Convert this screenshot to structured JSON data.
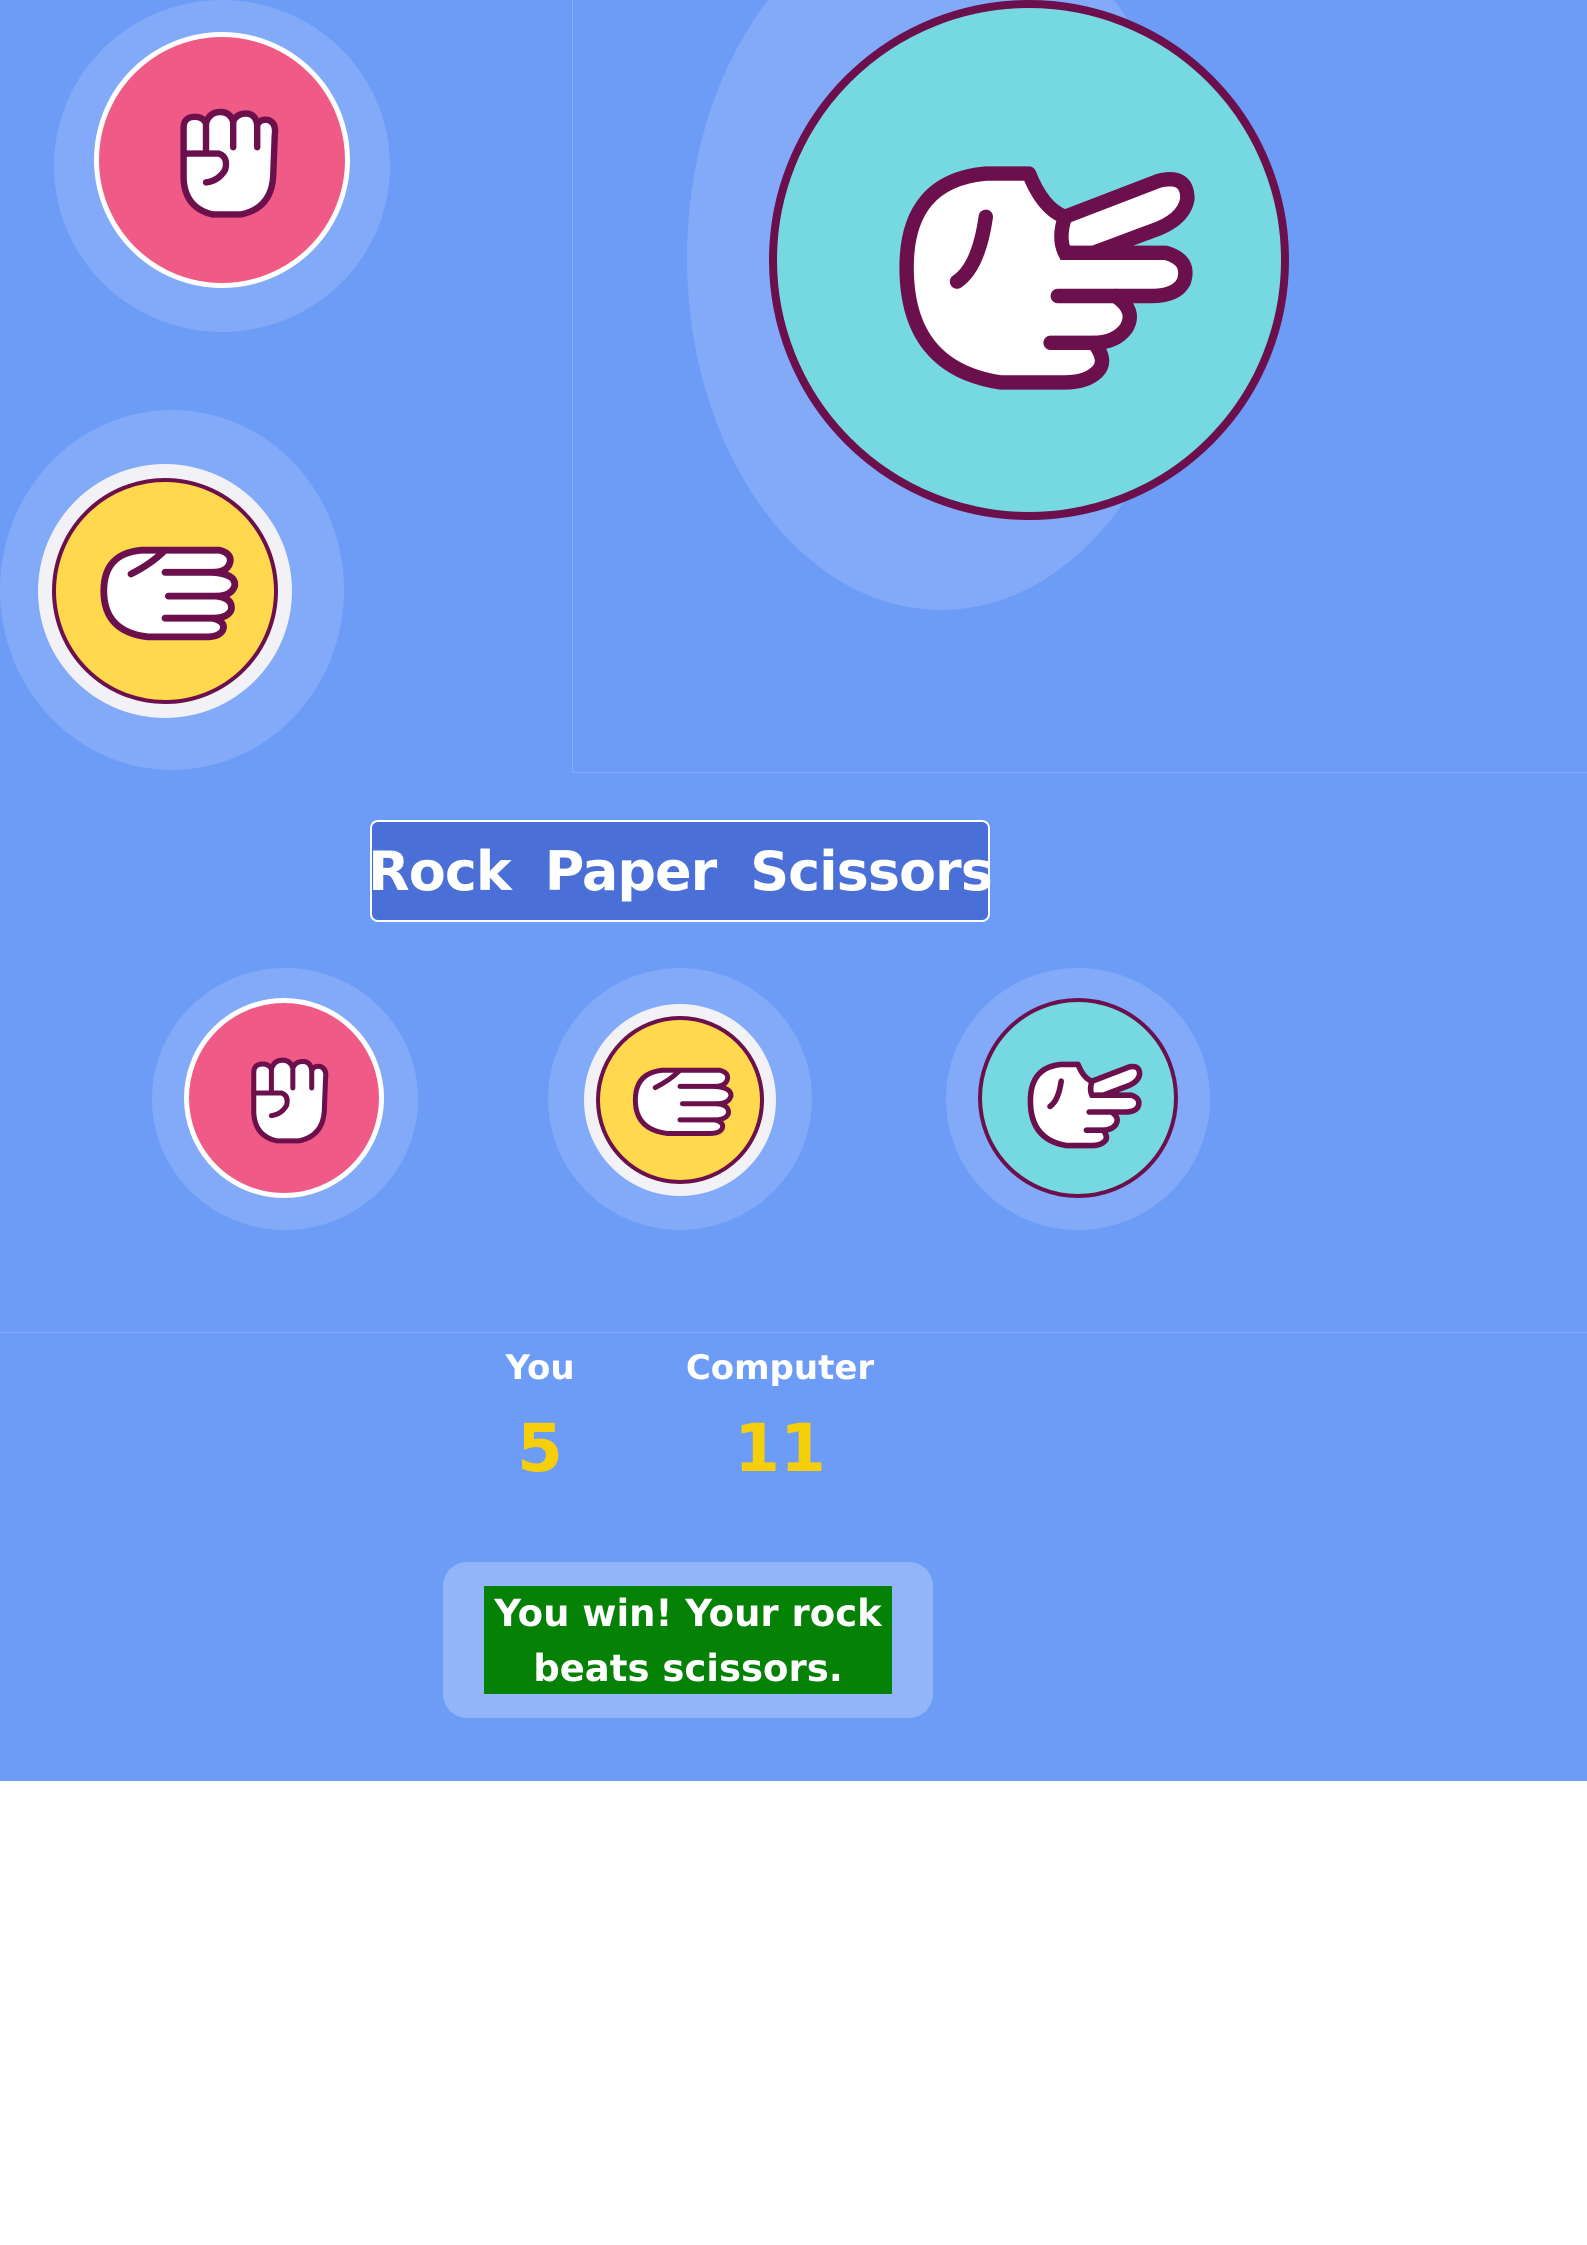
{
  "title": {
    "words": [
      "Rock",
      "Paper",
      "Scissors"
    ]
  },
  "choices": [
    {
      "id": "rock",
      "icon": "fist-icon",
      "color": "#ef5b86"
    },
    {
      "id": "paper",
      "icon": "open-hand-icon",
      "color": "#ffd84d"
    },
    {
      "id": "scissors",
      "icon": "two-fingers-icon",
      "color": "#76d8e0"
    }
  ],
  "score": {
    "player_label": "You",
    "player_value": "5",
    "computer_label": "Computer",
    "computer_value": "11"
  },
  "result": {
    "message": "You win! Your rock beats scissors.",
    "color": "#058105"
  },
  "colors": {
    "background": "#6d9cf6",
    "title_box": "#4a6fd6",
    "score_value": "#f6cf0a",
    "icon_outline": "#6b0f4d"
  }
}
